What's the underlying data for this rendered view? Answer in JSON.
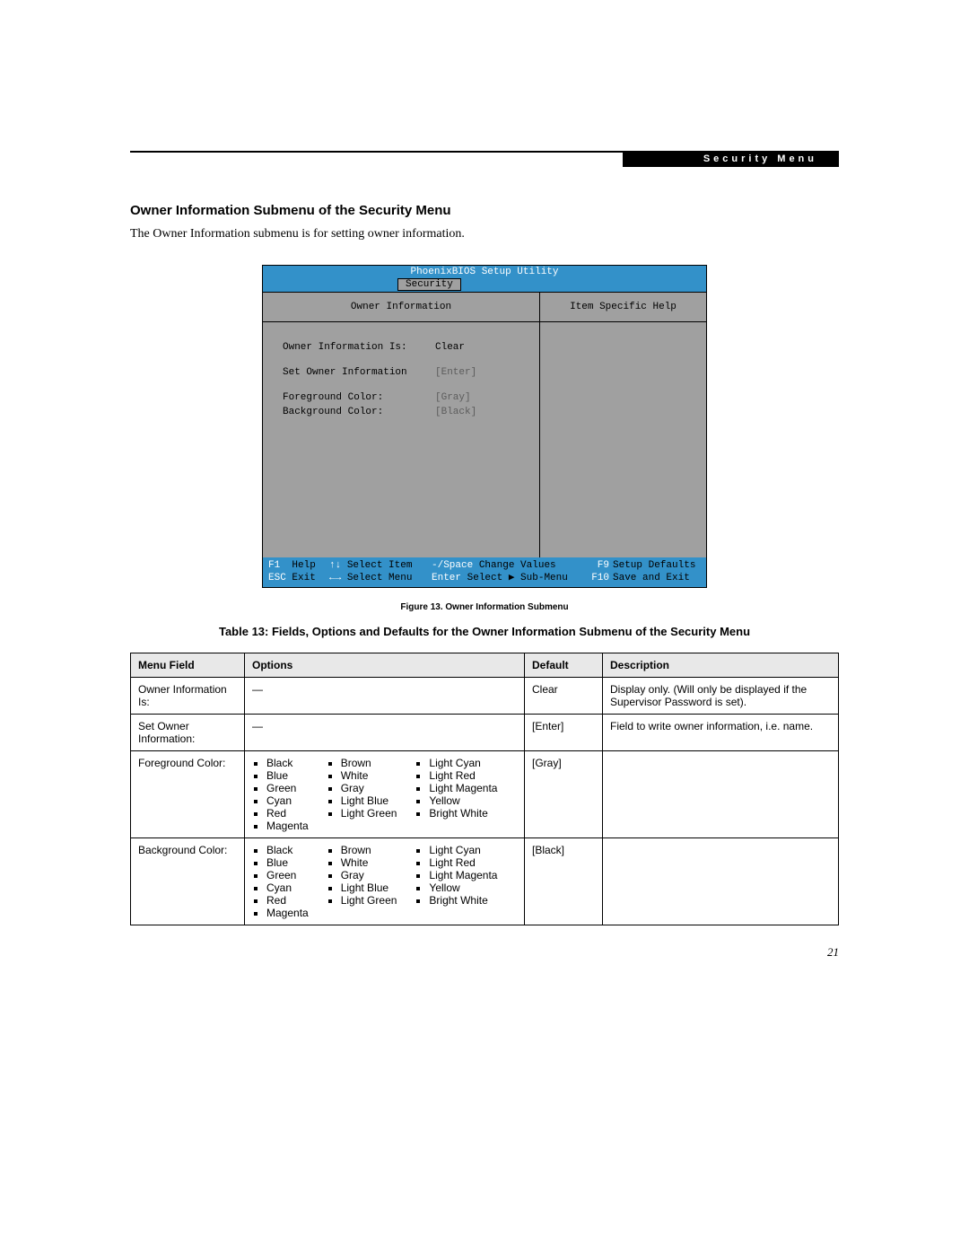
{
  "header": {
    "banner": "Security Menu"
  },
  "section": {
    "heading": "Owner Information Submenu of the Security Menu",
    "intro": "The Owner Information submenu is for setting owner information."
  },
  "bios": {
    "title": "PhoenixBIOS Setup Utility",
    "tab": "Security",
    "panel_title": "Owner Information",
    "help_title": "Item Specific Help",
    "rows": {
      "r1_label": "Owner Information Is:",
      "r1_value": "Clear",
      "r2_label": "Set Owner Information",
      "r2_value": "[Enter]",
      "r3_label": "Foreground Color:",
      "r3_value": "[Gray]",
      "r4_label": "Background Color:",
      "r4_value": "[Black]"
    },
    "footer": {
      "f1_key": "F1",
      "f1": "Help",
      "updn_key": "↑↓",
      "updn": "Select Item",
      "chg_key": "-/Space",
      "chg": "Change Values",
      "f9_key": "F9",
      "f9": "Setup Defaults",
      "esc_key": "ESC",
      "esc": "Exit",
      "lr_key": "←→",
      "lr": "Select Menu",
      "enter_key": "Enter",
      "enter": "Select ▶ Sub-Menu",
      "f10_key": "F10",
      "f10": "Save and Exit"
    }
  },
  "figcap": "Figure 13.   Owner Information Submenu",
  "table": {
    "title": "Table 13: Fields, Options and Defaults for the Owner Information Submenu of the Security Menu",
    "headers": {
      "field": "Menu Field",
      "options": "Options",
      "default": "Default",
      "description": "Description"
    },
    "rows": {
      "r1": {
        "field": "Owner Information Is:",
        "options_dash": "—",
        "default": "Clear",
        "description": "Display only. (Will only be displayed if the Supervisor Password is set)."
      },
      "r2": {
        "field": "Set Owner Information:",
        "options_dash": "—",
        "default": "[Enter]",
        "description": "Field to write owner information, i.e. name."
      },
      "r3": {
        "field": "Foreground Color:",
        "default": "[Gray]",
        "description": ""
      },
      "r4": {
        "field": "Background Color:",
        "default": "[Black]",
        "description": ""
      }
    },
    "color_options": {
      "c1": [
        "Black",
        "Blue",
        "Green",
        "Cyan",
        "Red",
        "Magenta"
      ],
      "c2": [
        "Brown",
        "White",
        "Gray",
        "Light Blue",
        "Light Green"
      ],
      "c3": [
        "Light Cyan",
        "Light Red",
        "Light Magenta",
        "Yellow",
        "Bright White"
      ]
    }
  },
  "page_number": "21"
}
